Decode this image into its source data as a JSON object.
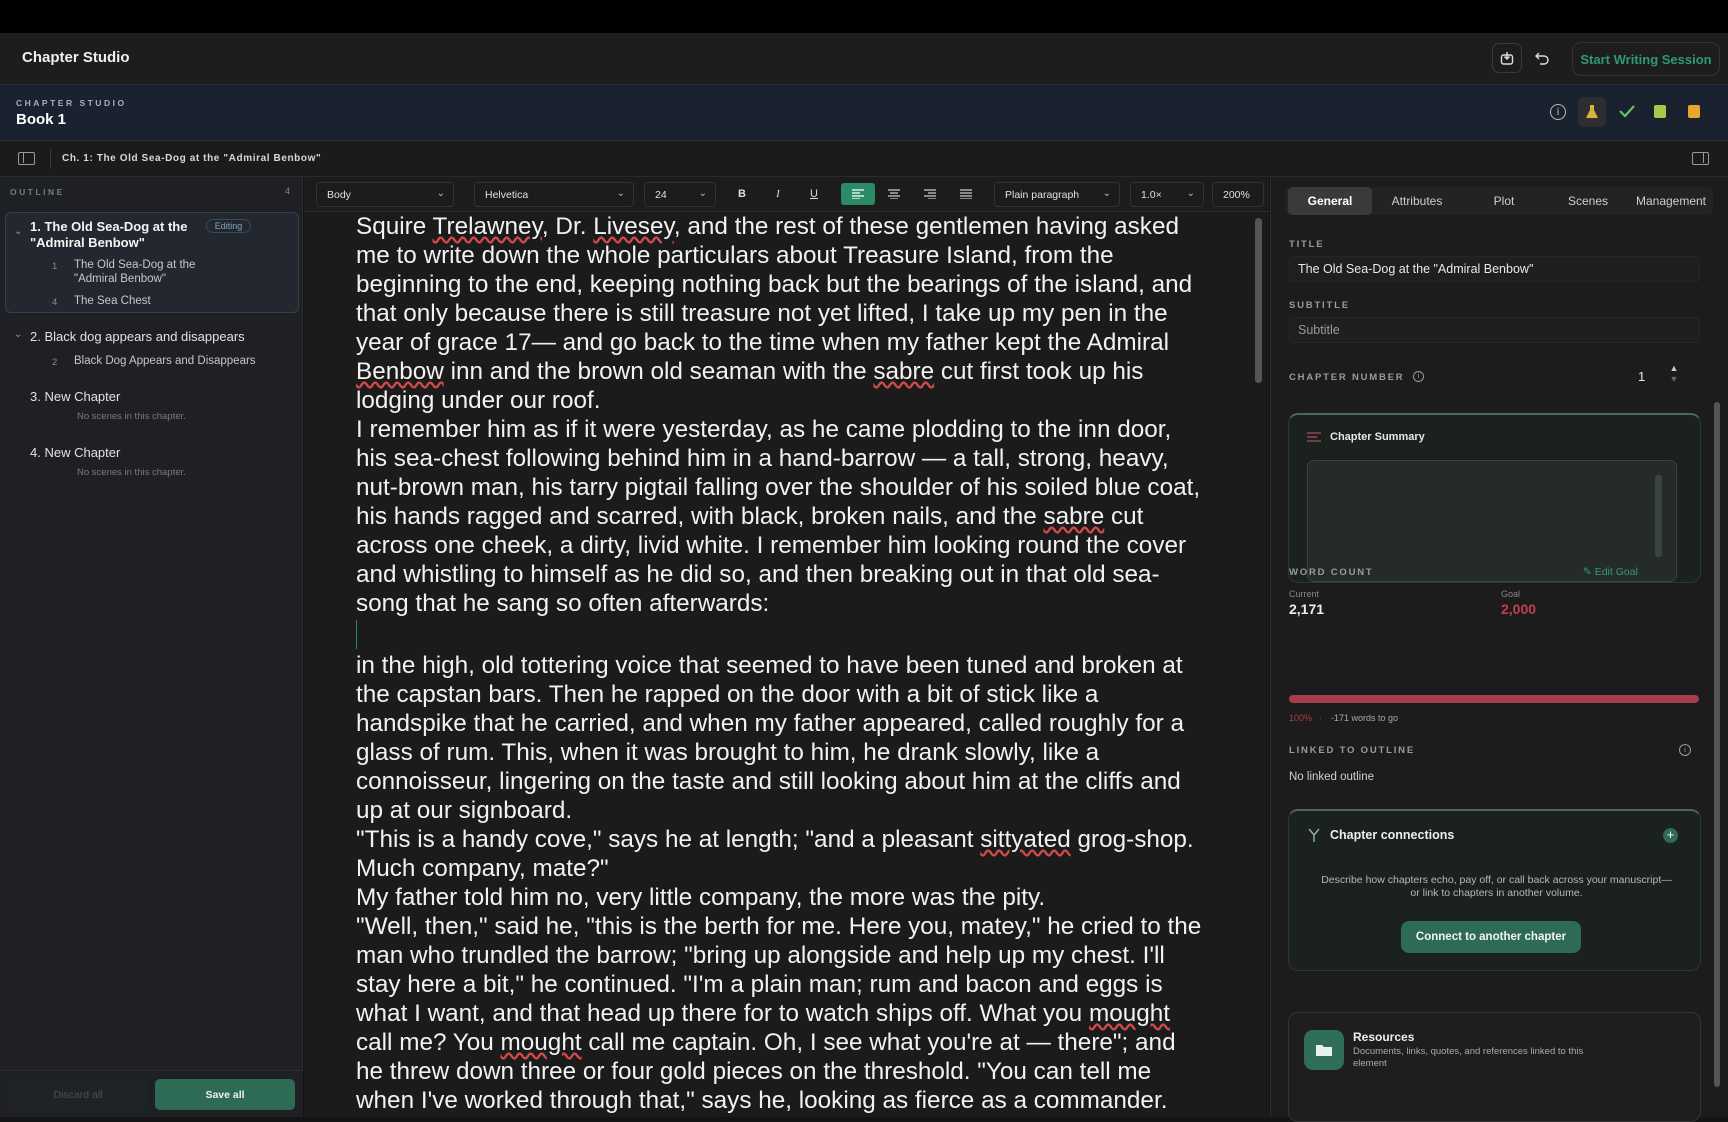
{
  "app": {
    "title": "Chapter Studio",
    "start_session": "Start Writing Session"
  },
  "book": {
    "section": "CHAPTER STUDIO",
    "title": "Book 1"
  },
  "breadcrumb": "Ch. 1: The Old Sea-Dog at the \"Admiral Benbow\"",
  "outline": {
    "heading": "OUTLINE",
    "count": "4",
    "chapters": [
      {
        "label": "1. The Old Sea-Dog at the \"Admiral Benbow\"",
        "badge": "Editing",
        "scenes": [
          {
            "n": "1",
            "label": "The Old Sea-Dog at the \"Admiral Benbow\""
          },
          {
            "n": "4",
            "label": "The Sea Chest"
          }
        ]
      },
      {
        "label": "2. Black dog appears and disappears",
        "scenes": [
          {
            "n": "2",
            "label": "Black Dog Appears and Disappears"
          }
        ]
      },
      {
        "label": "3. New Chapter",
        "empty": "No scenes in this chapter."
      },
      {
        "label": "4. New Chapter",
        "empty": "No scenes in this chapter."
      }
    ],
    "discard": "Discard all",
    "save": "Save all"
  },
  "toolbar": {
    "style": "Body",
    "font": "Helvetica",
    "size": "24",
    "bold": "B",
    "italic": "I",
    "underline": "U",
    "block": "Plain paragraph",
    "spacing": "1.0×",
    "zoom": "200%"
  },
  "manuscript": {
    "p1a": "Squire ",
    "w1": "Trelawney",
    "p1b": ", Dr. ",
    "w2": "Livesey",
    "p1c": ", and the rest of these gentlemen having asked me to write down the whole particulars about Treasure Island, from the beginning to the end, keeping nothing back but the bearings of the island, and that only because there is still treasure not yet lifted, I take up my pen in the year of grace 17— and go back to the time when my father kept the Admiral ",
    "w3": "Benbow",
    "p1d": " inn and the brown old seaman with the ",
    "w4": "sabre",
    "p1e": " cut first took up his lodging under our roof.",
    "p2a": "I remember him as if it were yesterday, as he came plodding to the inn door, his sea-chest following behind him in a hand-barrow — a tall, strong, heavy, nut-brown man, his tarry pigtail falling over the shoulder of his soiled blue coat, his hands ragged and scarred, with black, broken nails, and the ",
    "w5": "sabre",
    "p2b": " cut across one cheek, a dirty, livid white. I remember him looking round the cover and whistling to himself as he did so, and then breaking out in that old sea-song that he sang so often afterwards:",
    "p3": "in the high, old tottering voice that seemed to have been tuned and broken at the capstan bars. Then he rapped on the door with a bit of stick like a handspike that he carried, and when my father appeared, called roughly for a glass of rum. This, when it was brought to him, he drank slowly, like a connoisseur, lingering on the taste and still looking about him at the cliffs and up at our signboard.",
    "p4a": "\"This is a handy cove,\" says he at length; \"and a pleasant ",
    "w6": "sittyated",
    "p4b": " grog-shop. Much company, mate?\"",
    "p5": "My father told him no, very little company, the more was the pity.",
    "p6a": "\"Well, then,\" said he, \"this is the berth for me. Here you, matey,\" he cried to the man who trundled the barrow; \"bring up alongside and help up my chest. I'll stay here a bit,\" he continued. \"I'm a plain man; rum and bacon and eggs is what I want, and that head up there for to watch ships off. What you ",
    "w7": "mought",
    "p6b": " call me? You ",
    "w8": "mought",
    "p6c": " call me captain. Oh, I see what you're at — there\"; and he threw down three or four gold pieces on the threshold. \"You can tell me when I've worked through that,\" says he, looking as fierce as a commander."
  },
  "panel": {
    "tabs": [
      "General",
      "Attributes",
      "Plot",
      "Scenes",
      "Management"
    ],
    "title_label": "TITLE",
    "title_value": "The Old Sea-Dog at the \"Admiral Benbow\"",
    "subtitle_label": "SUBTITLE",
    "subtitle_placeholder": "Subtitle",
    "number_label": "CHAPTER NUMBER",
    "number_value": "1",
    "summary_title": "Chapter Summary",
    "wc_label": "WORD COUNT",
    "edit_goal": "Edit Goal",
    "current_label": "Current",
    "current_value": "2,171",
    "goal_label": "Goal",
    "goal_value": "2,000",
    "progress_pct": "100%",
    "progress_fraction": 1.0,
    "words_to_go": "-171 words to go",
    "linked_label": "LINKED TO OUTLINE",
    "linked_value": "No linked outline",
    "conn_title": "Chapter connections",
    "conn_desc": "Describe how chapters echo, pay off, or call back across your manuscript—or link to chapters in another volume.",
    "conn_button": "Connect to another chapter",
    "res_title": "Resources",
    "res_desc": "Documents, links, quotes, and references linked to this element"
  },
  "colors": {
    "accent": "#2d6b54",
    "accent_text": "#2f9a72",
    "progress": "#a83b4c",
    "goal": "#c0404f"
  }
}
